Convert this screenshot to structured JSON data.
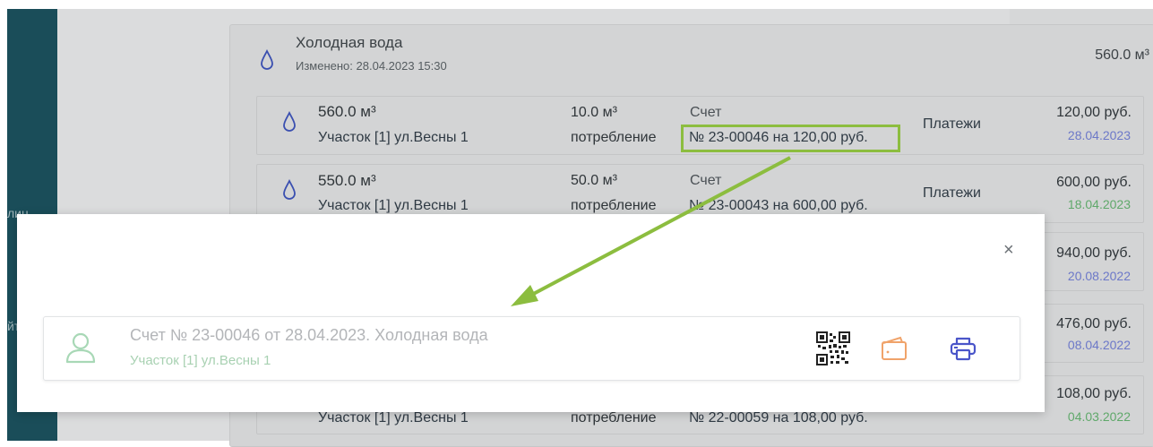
{
  "sidebar": {
    "partial_text_1": "лиц",
    "partial_text_2": "йт"
  },
  "group": {
    "title": "Холодная вода",
    "changed": "Изменено: 28.04.2023 15:30",
    "total": "560.0 м³"
  },
  "rows": [
    {
      "volume": "560.0 м³",
      "address": "Участок [1] ул.Весны 1",
      "consumption_value": "10.0 м³",
      "consumption_label": "потребление",
      "invoice_label": "Счет",
      "invoice": "№ 23-00046 на 120,00 руб.",
      "payments": "Платежи",
      "amount": "120,00 руб.",
      "date": "28.04.2023"
    },
    {
      "volume": "550.0 м³",
      "address": "Участок [1] ул.Весны 1",
      "consumption_value": "50.0 м³",
      "consumption_label": "потребление",
      "invoice_label": "Счет",
      "invoice": "№ 23-00043 на 600,00 руб.",
      "payments": "Платежи",
      "amount": "600,00 руб.",
      "date": "18.04.2023"
    },
    {
      "amount": "940,00 руб.",
      "date": "20.08.2022"
    },
    {
      "amount": "476,00 руб.",
      "date": "08.04.2022"
    },
    {
      "address": "Участок [1] ул.Весны 1",
      "consumption_label": "потребление",
      "invoice": "№ 22-00059 на 108,00 руб.",
      "amount": "108,00 руб.",
      "date": "04.03.2022"
    }
  ],
  "modal": {
    "close_label": "×",
    "invoice_title": "Счет № 23-00046 от 28.04.2023. Холодная вода",
    "invoice_address": "Участок [1] ул.Весны 1",
    "icons": [
      "qr-code-icon",
      "wallet-icon",
      "printer-icon"
    ]
  },
  "colors": {
    "sidebar": "#1a4d59",
    "highlight": "#8cbd3f",
    "date_blue": "#6c78c8",
    "date_green": "#5fa86a",
    "wallet": "#f0a36a",
    "printer": "#4a55c9",
    "user_icon": "#a8d8b6"
  }
}
